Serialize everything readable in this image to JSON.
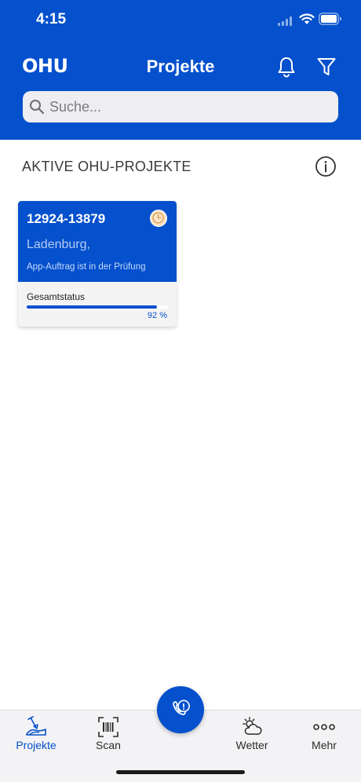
{
  "status_bar": {
    "time": "4:15"
  },
  "header": {
    "logo": "OHU",
    "title": "Projekte",
    "icons": [
      "bell-icon",
      "filter-icon"
    ]
  },
  "search": {
    "placeholder": "Suche...",
    "value": ""
  },
  "section": {
    "title": "AKTIVE OHU-PROJEKTE",
    "icon": "info-icon"
  },
  "projects": [
    {
      "number": "12924-13879",
      "city": "Ladenburg,",
      "status": "App-Auftrag ist in der Prüfung",
      "overall_label": "Gesamtstatus",
      "progress_percent": 92,
      "progress_text": "92 %",
      "badge_icon": "clock-icon"
    }
  ],
  "tab_bar": {
    "tabs": [
      {
        "label": "Projekte",
        "icon": "projects-icon",
        "active": true
      },
      {
        "label": "Scan",
        "icon": "barcode-scan-icon",
        "active": false
      },
      {
        "label": "Wetter",
        "icon": "weather-icon",
        "active": false
      },
      {
        "label": "Mehr",
        "icon": "more-icon",
        "active": false
      }
    ],
    "fab_icon": "phone-icon"
  },
  "colors": {
    "brand_blue": "#0450cd",
    "background": "#ffffff",
    "tab_bar_bg": "#f3f3f5"
  }
}
